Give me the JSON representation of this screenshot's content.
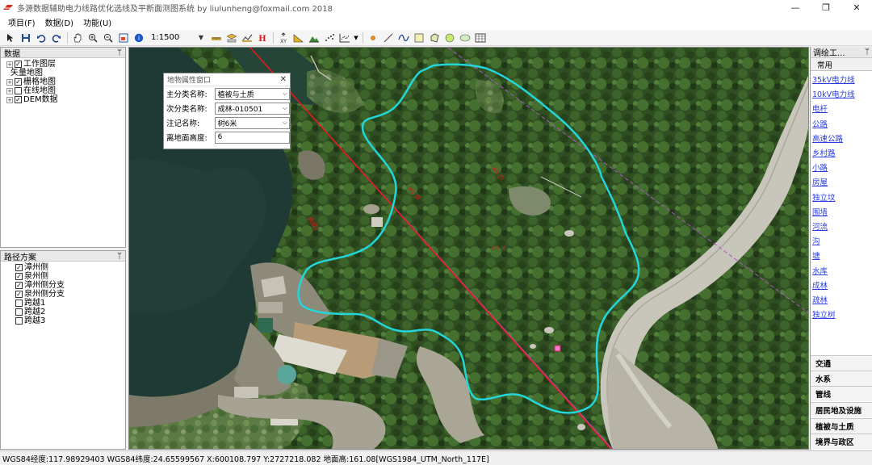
{
  "window": {
    "title": "多源数据辅助电力线路优化选线及平断面测图系统 by liulunheng@foxmail.com 2018",
    "controls": {
      "minimize": "—",
      "maximize": "❐",
      "close": "✕"
    }
  },
  "menu": [
    "项目(F)",
    "数据(D)",
    "功能(U)"
  ],
  "toolbar": {
    "scale": "1:1500",
    "icons": [
      "pointer-icon",
      "save-icon",
      "undo-icon",
      "redo-icon",
      "pan-hand-icon",
      "zoom-in-icon",
      "zoom-out-icon",
      "full-extent-icon",
      "identify-info-icon",
      "ruler-icon",
      "layer-icon",
      "profile-icon",
      "h-marker-icon",
      "xy-coordinate-icon",
      "slope-icon",
      "terrain-icon",
      "point-cloud-icon",
      "chart-icon",
      "point-icon",
      "line-icon",
      "curve-icon",
      "rectangle-icon",
      "polygon-icon",
      "circle-icon",
      "ellipse-icon",
      "table-icon"
    ]
  },
  "data_panel": {
    "title": "数据",
    "pin": "ᛘ",
    "items": [
      {
        "label": "工作图层",
        "level": 0,
        "expander": "+",
        "checked": true
      },
      {
        "label": "矢量地图",
        "level": 1,
        "expander": "",
        "checked": null
      },
      {
        "label": "栅格地图",
        "level": 0,
        "expander": "+",
        "checked": true
      },
      {
        "label": "在线地图",
        "level": 0,
        "expander": "+",
        "checked": false
      },
      {
        "label": "DEM数据",
        "level": 0,
        "expander": "+",
        "checked": true
      }
    ]
  },
  "route_panel": {
    "title": "路径方案",
    "pin": "ᛘ",
    "items": [
      {
        "label": "漳州侧",
        "checked": true
      },
      {
        "label": "泉州侧",
        "checked": true
      },
      {
        "label": "漳州侧分支",
        "checked": true
      },
      {
        "label": "泉州侧分支",
        "checked": true
      },
      {
        "label": "跨越1",
        "checked": false
      },
      {
        "label": "跨越2",
        "checked": false
      },
      {
        "label": "跨越3",
        "checked": false
      }
    ]
  },
  "attr_window": {
    "title": "地物属性窗口",
    "close": "✕",
    "rows": [
      {
        "label": "主分类名称:",
        "value": "植被与土质",
        "dropdown": true
      },
      {
        "label": "次分类名称:",
        "value": "成林-010501",
        "dropdown": true
      },
      {
        "label": "注记名称:",
        "value": "树6米",
        "dropdown": true
      },
      {
        "label": "离地面高度:",
        "value": "6",
        "dropdown": false
      }
    ]
  },
  "right_panel": {
    "title": "调绘工...",
    "pin": "ᛘ",
    "common_tab": "常用",
    "links": [
      "35kV电力线",
      "10kV电力线",
      "电杆",
      "公路",
      "高速公路",
      "乡村路",
      "小路",
      "房屋",
      "独立坟",
      "围墙",
      "河流",
      "沟",
      "塘",
      "水库",
      "成林",
      "疏林",
      "独立树"
    ],
    "categories": [
      "交通",
      "水系",
      "管线",
      "居民地及设施",
      "植被与土质",
      "境界与政区"
    ]
  },
  "map": {
    "line_labels": [
      "跨越1",
      "N1-J8",
      "N5-J5",
      "N5-J6"
    ],
    "colors": {
      "boundary": "#22d6d9",
      "route": "#e21a1a",
      "crossing": "#b055c8",
      "label": "#e01818"
    }
  },
  "status": {
    "text": "WGS84经度:117.98929403 WGS84纬度:24.65599567 X:600108.797 Y:2727218.082 地面高:161.08[WGS1984_UTM_North_117E]"
  }
}
